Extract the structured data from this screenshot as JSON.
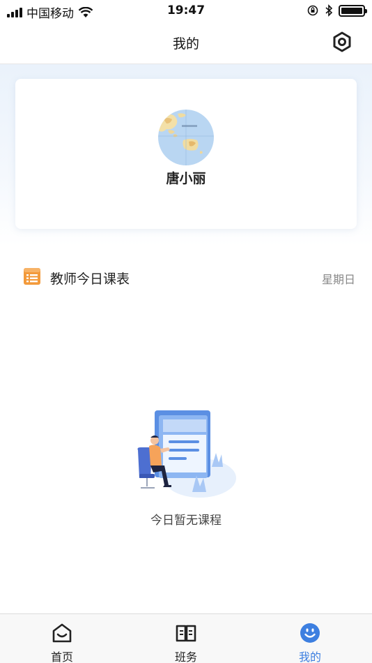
{
  "status_bar": {
    "carrier": "中国移动",
    "time": "19:47"
  },
  "nav": {
    "title": "我的",
    "settings_icon": "gear-hexagon-icon"
  },
  "profile": {
    "name": "唐小丽",
    "avatar_icon": "world-map-avatar"
  },
  "schedule": {
    "title": "教师今日课表",
    "day": "星期日",
    "icon": "list-icon",
    "empty_text": "今日暂无课程"
  },
  "tabs": [
    {
      "label": "首页",
      "icon": "home-icon",
      "active": false
    },
    {
      "label": "班务",
      "icon": "book-icon",
      "active": false
    },
    {
      "label": "我的",
      "icon": "smiley-icon",
      "active": true
    }
  ],
  "colors": {
    "accent": "#3d7fe0",
    "schedule_icon": "#f39a3b"
  }
}
